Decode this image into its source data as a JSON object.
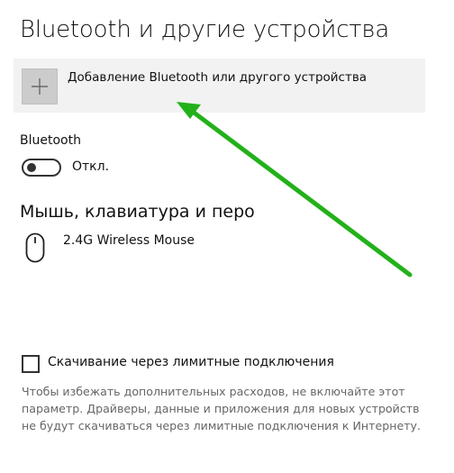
{
  "page": {
    "title": "Bluetooth и другие устройства"
  },
  "add_device": {
    "label": "Добавление Bluetooth или другого устройства",
    "icon": "plus-icon"
  },
  "bluetooth": {
    "label": "Bluetooth",
    "toggle_state": "Откл.",
    "enabled": false
  },
  "mouse_section": {
    "heading": "Мышь, клавиатура и перо",
    "devices": [
      {
        "name": "2.4G Wireless Mouse",
        "icon": "mouse-icon"
      }
    ]
  },
  "metered": {
    "checkbox_label": "Скачивание через лимитные подключения",
    "checked": false,
    "description": "Чтобы избежать дополнительных расходов, не включайте этот параметр. Драйверы, данные и приложения для новых устройств не будут скачиваться через лимитные подключения к Интернету."
  },
  "colors": {
    "annotation_arrow": "#22b11a",
    "add_tile": "#cccccc",
    "add_row_bg": "#f2f2f2",
    "description_text": "#666666"
  }
}
